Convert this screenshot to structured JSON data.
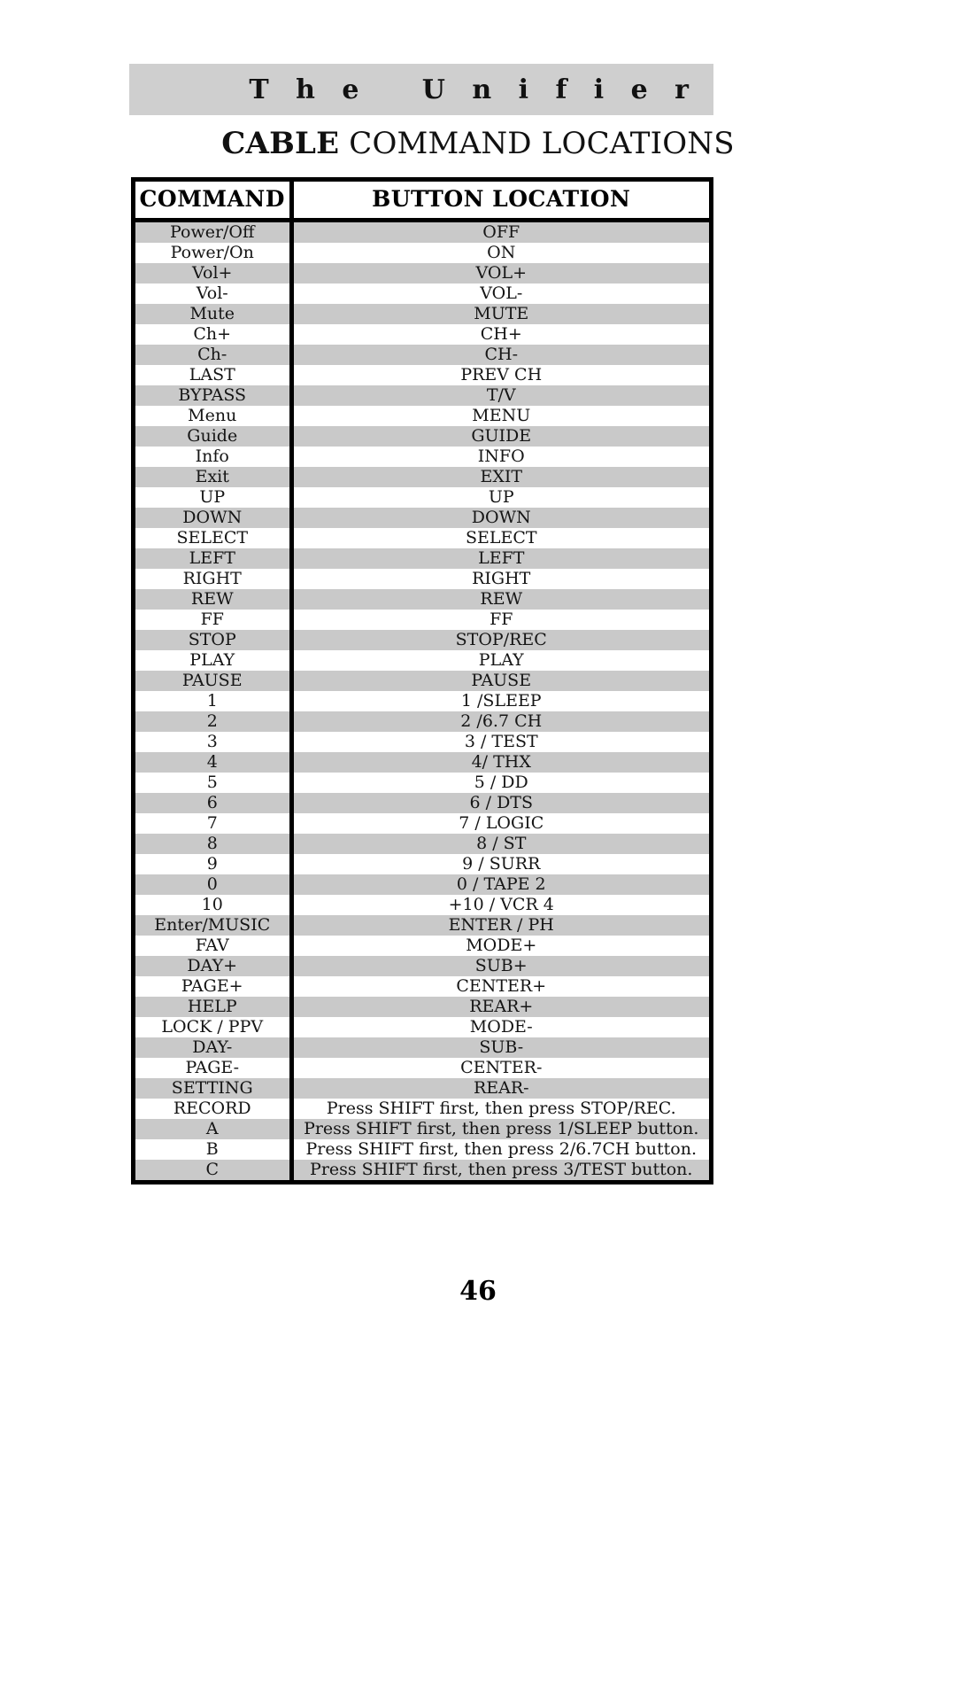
{
  "header": {
    "band_title": "T h e   U n i f i e r"
  },
  "title": {
    "bold_part": "CABLE",
    "rest_part": " COMMAND LOCATIONS"
  },
  "table": {
    "columns": [
      "COMMAND",
      "BUTTON LOCATION"
    ],
    "rows": [
      {
        "command": "Power/Off",
        "location": "OFF"
      },
      {
        "command": "Power/On",
        "location": "ON"
      },
      {
        "command": "Vol+",
        "location": "VOL+"
      },
      {
        "command": "Vol-",
        "location": "VOL-"
      },
      {
        "command": "Mute",
        "location": "MUTE"
      },
      {
        "command": "Ch+",
        "location": "CH+"
      },
      {
        "command": "Ch-",
        "location": "CH-"
      },
      {
        "command": "LAST",
        "location": "PREV CH"
      },
      {
        "command": "BYPASS",
        "location": "T/V"
      },
      {
        "command": "Menu",
        "location": "MENU"
      },
      {
        "command": "Guide",
        "location": "GUIDE"
      },
      {
        "command": "Info",
        "location": "INFO"
      },
      {
        "command": "Exit",
        "location": "EXIT"
      },
      {
        "command": "UP",
        "location": "UP"
      },
      {
        "command": "DOWN",
        "location": "DOWN"
      },
      {
        "command": "SELECT",
        "location": "SELECT"
      },
      {
        "command": "LEFT",
        "location": "LEFT"
      },
      {
        "command": "RIGHT",
        "location": "RIGHT"
      },
      {
        "command": "REW",
        "location": "REW"
      },
      {
        "command": "FF",
        "location": "FF"
      },
      {
        "command": "STOP",
        "location": "STOP/REC"
      },
      {
        "command": "PLAY",
        "location": "PLAY"
      },
      {
        "command": "PAUSE",
        "location": "PAUSE"
      },
      {
        "command": "1",
        "location": "1 /SLEEP"
      },
      {
        "command": "2",
        "location": "2 /6.7 CH"
      },
      {
        "command": "3",
        "location": "3 / TEST"
      },
      {
        "command": "4",
        "location": "4/ THX"
      },
      {
        "command": "5",
        "location": "5 / DD"
      },
      {
        "command": "6",
        "location": "6 / DTS"
      },
      {
        "command": "7",
        "location": "7 / LOGIC"
      },
      {
        "command": "8",
        "location": "8 / ST"
      },
      {
        "command": "9",
        "location": "9 / SURR"
      },
      {
        "command": "0",
        "location": "0 / TAPE 2"
      },
      {
        "command": "10",
        "location": "+10 / VCR 4"
      },
      {
        "command": "Enter/MUSIC",
        "location": "ENTER / PH"
      },
      {
        "command": "FAV",
        "location": "MODE+"
      },
      {
        "command": "DAY+",
        "location": "SUB+"
      },
      {
        "command": "PAGE+",
        "location": "CENTER+"
      },
      {
        "command": "HELP",
        "location": "REAR+"
      },
      {
        "command": "LOCK / PPV",
        "location": "MODE-"
      },
      {
        "command": "DAY-",
        "location": "SUB-"
      },
      {
        "command": "PAGE-",
        "location": "CENTER-"
      },
      {
        "command": "SETTING",
        "location": "REAR-"
      },
      {
        "command": "RECORD",
        "location": "Press SHIFT first, then press STOP/REC."
      },
      {
        "command": "A",
        "location": "Press SHIFT first, then press 1/SLEEP button."
      },
      {
        "command": "B",
        "location": "Press SHIFT first, then press 2/6.7CH button."
      },
      {
        "command": "C",
        "location": "Press SHIFT first, then press 3/TEST button."
      }
    ]
  },
  "footer": {
    "page_number": "46"
  },
  "colors": {
    "band_gray": "#cfcfcf",
    "row_shade": "#c9c9c9",
    "border": "#000000",
    "text": "#151515"
  }
}
